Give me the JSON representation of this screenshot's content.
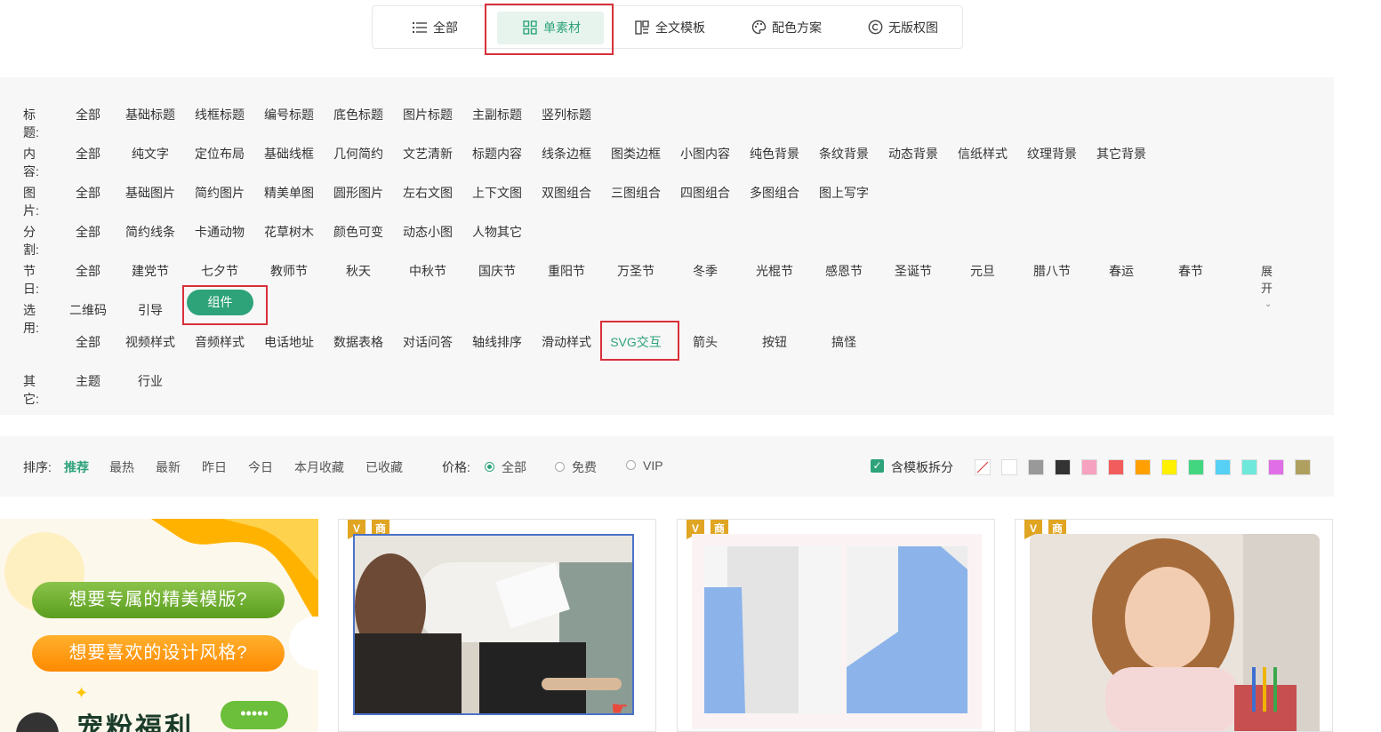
{
  "tabs": [
    {
      "label": "全部",
      "icon": "list-icon"
    },
    {
      "label": "单素材",
      "icon": "grid-icon"
    },
    {
      "label": "全文模板",
      "icon": "layout-icon"
    },
    {
      "label": "配色方案",
      "icon": "palette-icon"
    },
    {
      "label": "无版权图",
      "icon": "copyright-icon"
    }
  ],
  "filters": {
    "title": {
      "label": "标题:",
      "items": [
        "全部",
        "基础标题",
        "线框标题",
        "编号标题",
        "底色标题",
        "图片标题",
        "主副标题",
        "竖列标题"
      ]
    },
    "content": {
      "label": "内容:",
      "items": [
        "全部",
        "纯文字",
        "定位布局",
        "基础线框",
        "几何简约",
        "文艺清新",
        "标题内容",
        "线条边框",
        "图类边框",
        "小图内容",
        "纯色背景",
        "条纹背景",
        "动态背景",
        "信纸样式",
        "纹理背景",
        "其它背景"
      ]
    },
    "image": {
      "label": "图片:",
      "items": [
        "全部",
        "基础图片",
        "简约图片",
        "精美单图",
        "圆形图片",
        "左右文图",
        "上下文图",
        "双图组合",
        "三图组合",
        "四图组合",
        "多图组合",
        "图上写字"
      ]
    },
    "divider": {
      "label": "分割:",
      "items": [
        "全部",
        "简约线条",
        "卡通动物",
        "花草树木",
        "颜色可变",
        "动态小图",
        "人物其它"
      ]
    },
    "festival": {
      "label": "节日:",
      "items": [
        "全部",
        "建党节",
        "七夕节",
        "教师节",
        "秋天",
        "中秋节",
        "国庆节",
        "重阳节",
        "万圣节",
        "冬季",
        "光棍节",
        "感恩节",
        "圣诞节",
        "元旦",
        "腊八节",
        "春运",
        "春节"
      ],
      "expand": "展开"
    },
    "select": {
      "label": "选用:",
      "items": [
        "二维码",
        "引导"
      ],
      "active": "组件"
    },
    "sub": {
      "items": [
        "全部",
        "视频样式",
        "音频样式",
        "电话地址",
        "数据表格",
        "对话问答",
        "轴线排序",
        "滑动样式",
        "SVG交互",
        "箭头",
        "按钮",
        "搞怪"
      ]
    },
    "other": {
      "label": "其它:",
      "items": [
        "主题",
        "行业"
      ]
    }
  },
  "sort": {
    "label": "排序:",
    "items": [
      "推荐",
      "最热",
      "最新",
      "昨日",
      "今日",
      "本月收藏",
      "已收藏"
    ],
    "active": "推荐",
    "price_label": "价格:",
    "price_options": [
      "全部",
      "免费",
      "VIP"
    ],
    "price_selected": "全部",
    "split_label": "含模板拆分",
    "colors": [
      "#ffffff",
      "#999999",
      "#333333",
      "#f7a1c0",
      "#f25c5c",
      "#ff9f00",
      "#ffef00",
      "#43d680",
      "#56d0f4",
      "#6fe8dc",
      "#e06ee6",
      "#b0a060"
    ]
  },
  "promo": {
    "line1": "想要专属的精美模版?",
    "line2": "想要喜欢的设计风格?",
    "line3": "宠粉福利"
  },
  "badges": {
    "v": "V",
    "shang": "商"
  }
}
